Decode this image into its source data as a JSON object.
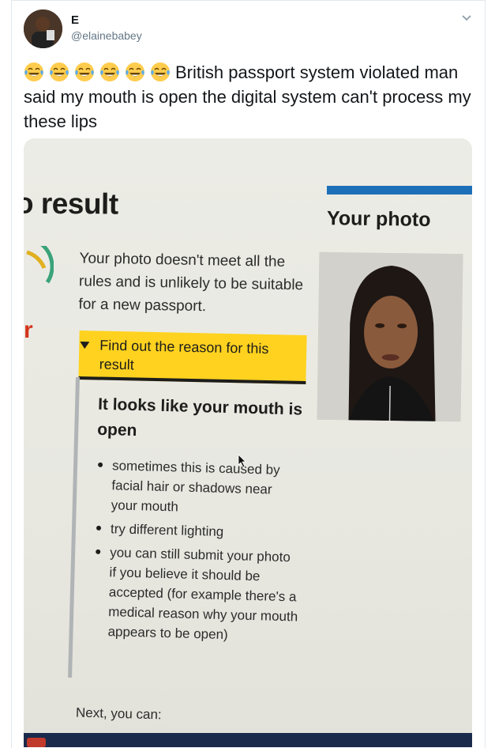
{
  "tweet": {
    "author_name": "E",
    "author_handle": "@elainebabey",
    "text": "British passport system violated man said my mouth is open the digital system can't process my these lips",
    "emoji_icon": "face-with-tears-of-joy-icon"
  },
  "embedded_screenshot": {
    "page_title": "o result",
    "side_heading": "Your photo",
    "status_message": "Your photo doesn't meet all the rules and is unlikely to be suitable for a new passport.",
    "details_summary": "Find out the reason for this result",
    "details_heading": "It looks like your mouth is open",
    "reasons": [
      "sometimes this is caused by facial hair or shadows near your mouth",
      "try different lighting",
      "you can still submit your photo if you believe it should be accepted (for example there's a medical reason why your mouth appears to be open)"
    ],
    "next_label": "Next, you can:",
    "result_letter": "r",
    "colors": {
      "accent_blue": "#1d70b8",
      "highlight_yellow": "#ffd21f",
      "warning_red": "#d4351c"
    }
  }
}
